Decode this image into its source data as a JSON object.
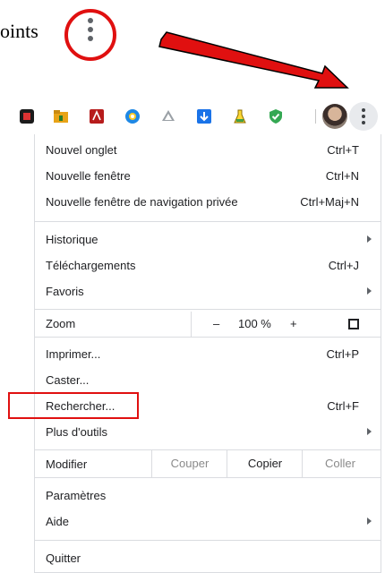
{
  "annotation": {
    "text": "oints",
    "accent_color": "#e01010",
    "icon": "three-dots-vertical-icon"
  },
  "toolbar": {
    "extensions": [
      "red-square-extension-icon",
      "folder-extension-icon",
      "pdf-extension-icon",
      "compass-extension-icon",
      "drive-extension-icon",
      "download-extension-icon",
      "flask-extension-icon",
      "shield-check-extension-icon"
    ],
    "avatar": "profile-avatar",
    "menu_icon": "three-dots-vertical-icon"
  },
  "menu": {
    "new_tab": {
      "label": "Nouvel onglet",
      "shortcut": "Ctrl+T"
    },
    "new_window": {
      "label": "Nouvelle fenêtre",
      "shortcut": "Ctrl+N"
    },
    "incognito": {
      "label": "Nouvelle fenêtre de navigation privée",
      "shortcut": "Ctrl+Maj+N"
    },
    "history": {
      "label": "Historique"
    },
    "downloads": {
      "label": "Téléchargements",
      "shortcut": "Ctrl+J"
    },
    "bookmarks": {
      "label": "Favoris"
    },
    "zoom": {
      "label": "Zoom",
      "minus": "–",
      "value": "100 %",
      "plus": "+"
    },
    "print": {
      "label": "Imprimer...",
      "shortcut": "Ctrl+P"
    },
    "cast": {
      "label": "Caster..."
    },
    "find": {
      "label": "Rechercher...",
      "shortcut": "Ctrl+F"
    },
    "more_tools": {
      "label": "Plus d'outils"
    },
    "edit": {
      "label": "Modifier",
      "cut": "Couper",
      "copy": "Copier",
      "paste": "Coller"
    },
    "settings": {
      "label": "Paramètres"
    },
    "help": {
      "label": "Aide"
    },
    "exit": {
      "label": "Quitter"
    }
  }
}
